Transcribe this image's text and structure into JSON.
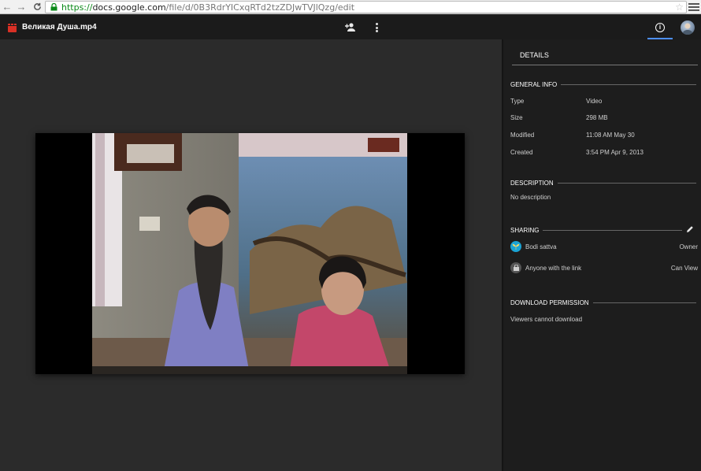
{
  "browser": {
    "url_scheme": "https://",
    "url_host": "docs.google.com",
    "url_path": "/file/d/0B3RdrYICxqRTd2tzZDJwTVJlQzg/edit"
  },
  "header": {
    "file_title": "Великая Душа.mp4"
  },
  "panel": {
    "title": "DETAILS",
    "general_info": {
      "heading": "GENERAL INFO",
      "rows": [
        {
          "label": "Type",
          "value": "Video"
        },
        {
          "label": "Size",
          "value": "298 MB"
        },
        {
          "label": "Modified",
          "value": "11:08 AM May 30"
        },
        {
          "label": "Created",
          "value": "3:54 PM Apr 9, 2013"
        }
      ]
    },
    "description": {
      "heading": "DESCRIPTION",
      "text": "No description"
    },
    "sharing": {
      "heading": "SHARING",
      "entries": [
        {
          "name": "Bodi sattva",
          "role": "Owner"
        },
        {
          "name": "Anyone with the link",
          "role": "Can View"
        }
      ]
    },
    "download": {
      "heading": "DOWNLOAD PERMISSION",
      "text": "Viewers cannot download"
    }
  },
  "colors": {
    "accent": "#4d90fe",
    "file_icon": "#d93025",
    "header_bg": "#1b1b1b",
    "viewer_bg": "#2b2b2b",
    "panel_bg": "#1d1d1d"
  },
  "icons": [
    "back-icon",
    "forward-icon",
    "reload-icon",
    "lock-icon",
    "star-icon",
    "chrome-menu-icon",
    "video-file-icon",
    "add-person-icon",
    "more-vert-icon",
    "info-icon",
    "avatar",
    "edit-icon",
    "user-avatar-icon",
    "link-icon"
  ]
}
